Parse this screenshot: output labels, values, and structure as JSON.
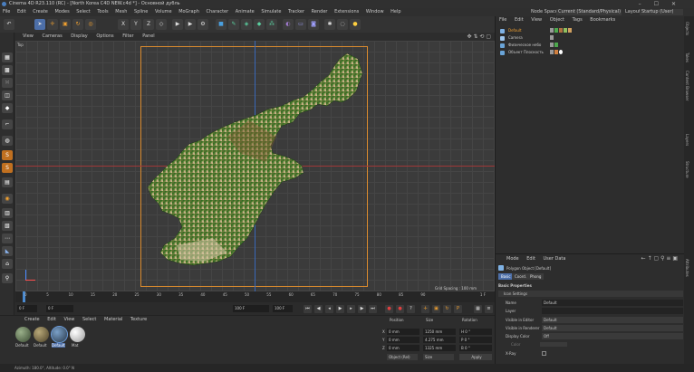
{
  "window": {
    "title": "Cinema 4D R23.110 (RC) - [North Korea C4D NEW.c4d *] - Основной дубль",
    "controls": [
      "–",
      "☐",
      "✕"
    ]
  },
  "menu": {
    "items": [
      "File",
      "Edit",
      "Create",
      "Modes",
      "Select",
      "Tools",
      "Mesh",
      "Spline",
      "Volume",
      "MoGraph",
      "Character",
      "Animate",
      "Simulate",
      "Tracker",
      "Render",
      "Extensions",
      "Window",
      "Help"
    ],
    "node_space_label": "Node Space:",
    "node_space_value": "Current (Standard/Physical)",
    "layout_label": "Layout:",
    "layout_value": "Startup (User)"
  },
  "viewport": {
    "menu": [
      "View",
      "Cameras",
      "Display",
      "Options",
      "Filter",
      "Panel"
    ],
    "view_name": "Top",
    "grid_spacing": "Grid Spacing : 100 mm",
    "accent": "#d98a2e"
  },
  "timeline": {
    "ticks": [
      "0",
      "5",
      "10",
      "15",
      "20",
      "25",
      "30",
      "35",
      "40",
      "45",
      "50",
      "55",
      "60",
      "65",
      "70",
      "75",
      "80",
      "85",
      "90"
    ],
    "end_marker": "1 F",
    "start_field": "0 F",
    "current_field": "0 F",
    "end_field": "100 F",
    "end_field2": "100 F"
  },
  "materials": {
    "menu": [
      "Create",
      "Edit",
      "View",
      "Select",
      "Material",
      "Texture"
    ],
    "items": [
      "Default",
      "Default",
      "Default",
      "Mat"
    ]
  },
  "coords": {
    "headers": [
      "Position",
      "Size",
      "Rotation"
    ],
    "rows": [
      {
        "axis": "X",
        "pos": "0 mm",
        "size": "1250 mm",
        "rot": "H  0 °"
      },
      {
        "axis": "Y",
        "pos": "0 mm",
        "size": "4.275 mm",
        "rot": "P  0 °"
      },
      {
        "axis": "Z",
        "pos": "0 mm",
        "size": "1325 mm",
        "rot": "B  0 °"
      }
    ],
    "mode": "Object (Rel)",
    "size_mode": "Size",
    "apply": "Apply"
  },
  "objects": {
    "menu": [
      "File",
      "Edit",
      "View",
      "Object",
      "Tags",
      "Bookmarks"
    ],
    "rows": [
      {
        "name": "Default",
        "color": "#7fb2e5"
      },
      {
        "name": "Camera",
        "color": "#9fc7ee"
      },
      {
        "name": "Физическое небо",
        "color": "#6aa4d8"
      },
      {
        "name": "Объект Плоскость",
        "color": "#6aa4d8"
      }
    ]
  },
  "attributes": {
    "menu": [
      "Mode",
      "Edit",
      "User Data"
    ],
    "object_label": "Polygon Object [Default]",
    "tabs": [
      "Basic",
      "Coord.",
      "Phong"
    ],
    "section": "Basic Properties",
    "subsection": "Icon Settings",
    "fields": [
      {
        "label": "Name",
        "value": "Default"
      },
      {
        "label": "Layer",
        "value": ""
      },
      {
        "label": "Visible in Editor",
        "value": "Default"
      },
      {
        "label": "Visible in Renderer",
        "value": "Default"
      },
      {
        "label": "Display Color",
        "value": "Off"
      },
      {
        "label": "Color",
        "value": ""
      },
      {
        "label": "X-Ray",
        "value": ""
      }
    ]
  },
  "side_tabs": [
    "Objects",
    "Takes",
    "Content Browser",
    "Layers",
    "Structure",
    "Attributes"
  ],
  "status": "Azimuth: 180.0°, Altitude: 0.0° N"
}
